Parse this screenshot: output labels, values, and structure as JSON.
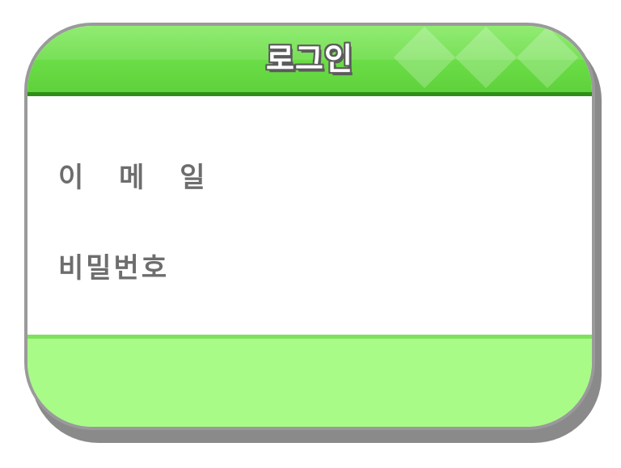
{
  "dialog": {
    "title": "로그인",
    "email_label": "이 메 일",
    "password_label": "비밀번호"
  },
  "colors": {
    "header_green": "#6dde49",
    "header_border": "#2f8e16",
    "footer_green": "#a8fb87",
    "label_gray": "#6d6d6d"
  }
}
